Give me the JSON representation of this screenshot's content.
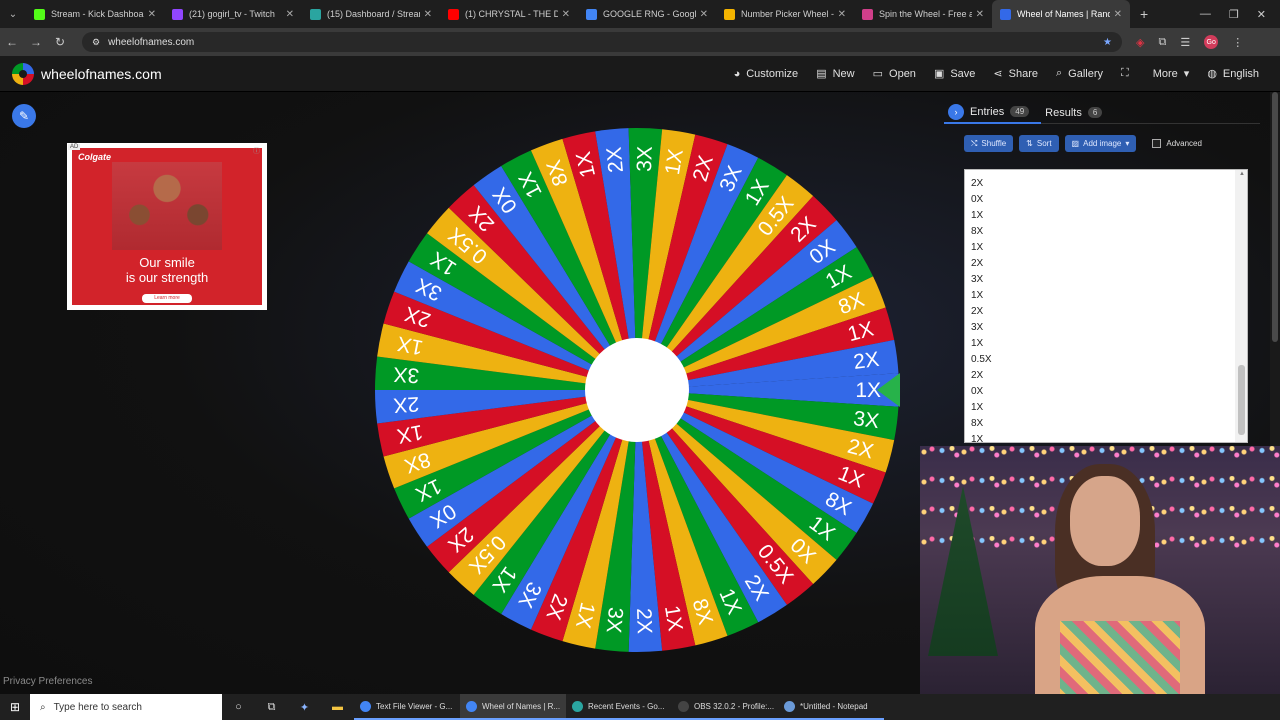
{
  "browser": {
    "tabs": [
      {
        "label": "Stream - Kick Dashboard",
        "color": "#53fc18"
      },
      {
        "label": "(21) gogirl_tv - Twitch",
        "color": "#9146ff"
      },
      {
        "label": "(15) Dashboard / Streaml",
        "color": "#2aa5a0"
      },
      {
        "label": "(1) CHRYSTAL - THE D",
        "color": "#ff0000"
      },
      {
        "label": "GOOGLE RNG - Google S",
        "color": "#4285f4"
      },
      {
        "label": "Number Picker Wheel - P",
        "color": "#f4b400"
      },
      {
        "label": "Spin the Wheel - Free an",
        "color": "#d13f8a"
      },
      {
        "label": "Wheel of Names | Rando",
        "color": "#3369e8",
        "active": true
      }
    ],
    "url": "wheelofnames.com",
    "profile_initials": "Go"
  },
  "site": {
    "name": "wheelofnames.com",
    "menu": [
      {
        "label": "Customize",
        "icon": "palette-icon",
        "glyph": "◕"
      },
      {
        "label": "New",
        "icon": "file-icon",
        "glyph": "▤"
      },
      {
        "label": "Open",
        "icon": "folder-icon",
        "glyph": "▭"
      },
      {
        "label": "Save",
        "icon": "save-icon",
        "glyph": "▣"
      },
      {
        "label": "Share",
        "icon": "share-icon",
        "glyph": "⋖"
      },
      {
        "label": "Gallery",
        "icon": "search-icon",
        "glyph": "⌕"
      },
      {
        "label": "",
        "icon": "fullscreen-icon",
        "glyph": "⛶"
      },
      {
        "label": "More",
        "icon": "chevron-down-icon",
        "glyph": "▾"
      },
      {
        "label": "English",
        "icon": "globe-icon",
        "glyph": "◍"
      }
    ]
  },
  "ad": {
    "tag": "AD",
    "brand": "Colgate",
    "line1": "Our smile",
    "line2": "is our strength",
    "cta": "Learn more"
  },
  "privacy_link": "Privacy Preferences",
  "panel": {
    "tabs": [
      {
        "label": "Entries",
        "count": "49"
      },
      {
        "label": "Results",
        "count": "6"
      }
    ],
    "tools": {
      "shuffle": "Shuffle",
      "sort": "Sort",
      "add_image": "Add image",
      "advanced": "Advanced"
    },
    "entries_visible": [
      "0.5X",
      "2X",
      "0X",
      "1X",
      "8X",
      "1X",
      "2X",
      "3X",
      "1X",
      "2X",
      "3X",
      "1X",
      "0.5X",
      "2X",
      "0X",
      "1X",
      "8X",
      "1X"
    ]
  },
  "wheel": {
    "colors": [
      "#d50f25",
      "#3369e8",
      "#009925",
      "#eeb211"
    ],
    "pointer_color": "#27b24a",
    "start_color_index": 1,
    "labels": [
      "1X",
      "3X",
      "2X",
      "1X",
      "8X",
      "1X",
      "0X",
      "0.5X",
      "2X",
      "1X",
      "8X",
      "1X",
      "2X",
      "3X",
      "1X",
      "2X",
      "3X",
      "1X",
      "0.5X",
      "2X",
      "0X",
      "1X",
      "8X",
      "1X",
      "2X",
      "3X",
      "1X",
      "2X",
      "3X",
      "1X",
      "0.5X",
      "2X",
      "0X",
      "1X",
      "8X",
      "1X",
      "2X",
      "3X",
      "1X",
      "2X",
      "3X",
      "1X",
      "0.5X",
      "2X",
      "0X",
      "1X",
      "8X",
      "1X",
      "2X"
    ]
  },
  "taskbar": {
    "search_placeholder": "Type here to search",
    "apps": [
      {
        "label": "Text File Viewer - G...",
        "color": "#4285f4"
      },
      {
        "label": "Wheel of Names | R...",
        "color": "#4285f4",
        "active": true
      },
      {
        "label": "Recent Events - Go...",
        "color": "#2aa5a0"
      },
      {
        "label": "OBS 32.0.2 - Profile:...",
        "color": "#444444"
      },
      {
        "label": "*Untitled - Notepad",
        "color": "#6a9ad8"
      }
    ]
  }
}
